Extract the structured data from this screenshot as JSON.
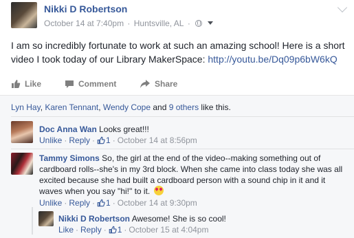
{
  "post": {
    "author": "Nikki D Robertson",
    "date": "October 14 at 7:40pm",
    "separator": "·",
    "location": "Huntsville, AL",
    "text_before_link": "I am so incredibly fortunate to work at such an amazing school! Here is a short video I took today of our Library MakerSpace: ",
    "link": "http://youtu.be/Dq09p6bW6kQ"
  },
  "actions": {
    "like": "Like",
    "comment": "Comment",
    "share": "Share"
  },
  "likers": {
    "name1": "Lyn Hay",
    "sep1": ", ",
    "name2": "Karen Tennant",
    "sep2": ", ",
    "name3": "Wendy Cope",
    "and": " and ",
    "others": "9 others",
    "suffix": " like this."
  },
  "comments": [
    {
      "author": "Doc Anna Wan",
      "text": " Looks great!!!",
      "action": "Unlike",
      "reply": "Reply",
      "likes": "1",
      "time": "October 14 at 8:56pm"
    },
    {
      "author": "Tammy Simons",
      "text": " So, the girl at the end of the video--making something out of cardboard rolls--she's in my 3rd block. When she came into class today she was all excited because she had built a cardboard person with a sound chip in it and it waves when you say \"hi!\" to it.",
      "action": "Unlike",
      "reply": "Reply",
      "likes": "1",
      "time": "October 14 at 9:30pm"
    },
    {
      "author": "Nikki D Robertson",
      "text": " Awesome! She is so cool!",
      "action": "Like",
      "reply": "Reply",
      "likes": "1",
      "time": "October 15 at 4:04pm"
    }
  ],
  "icons": {
    "globe": "globe-icon",
    "audience": "chevron-down-icon",
    "like": "thumbs-up-icon",
    "comment": "comment-bubble-icon",
    "share": "share-arrow-icon",
    "emoji": "heart-eyes-emoji-icon"
  },
  "colors": {
    "link": "#365899",
    "meta": "#90949c",
    "action": "#7f7f7f",
    "ufi_bg": "#f6f7f9"
  }
}
